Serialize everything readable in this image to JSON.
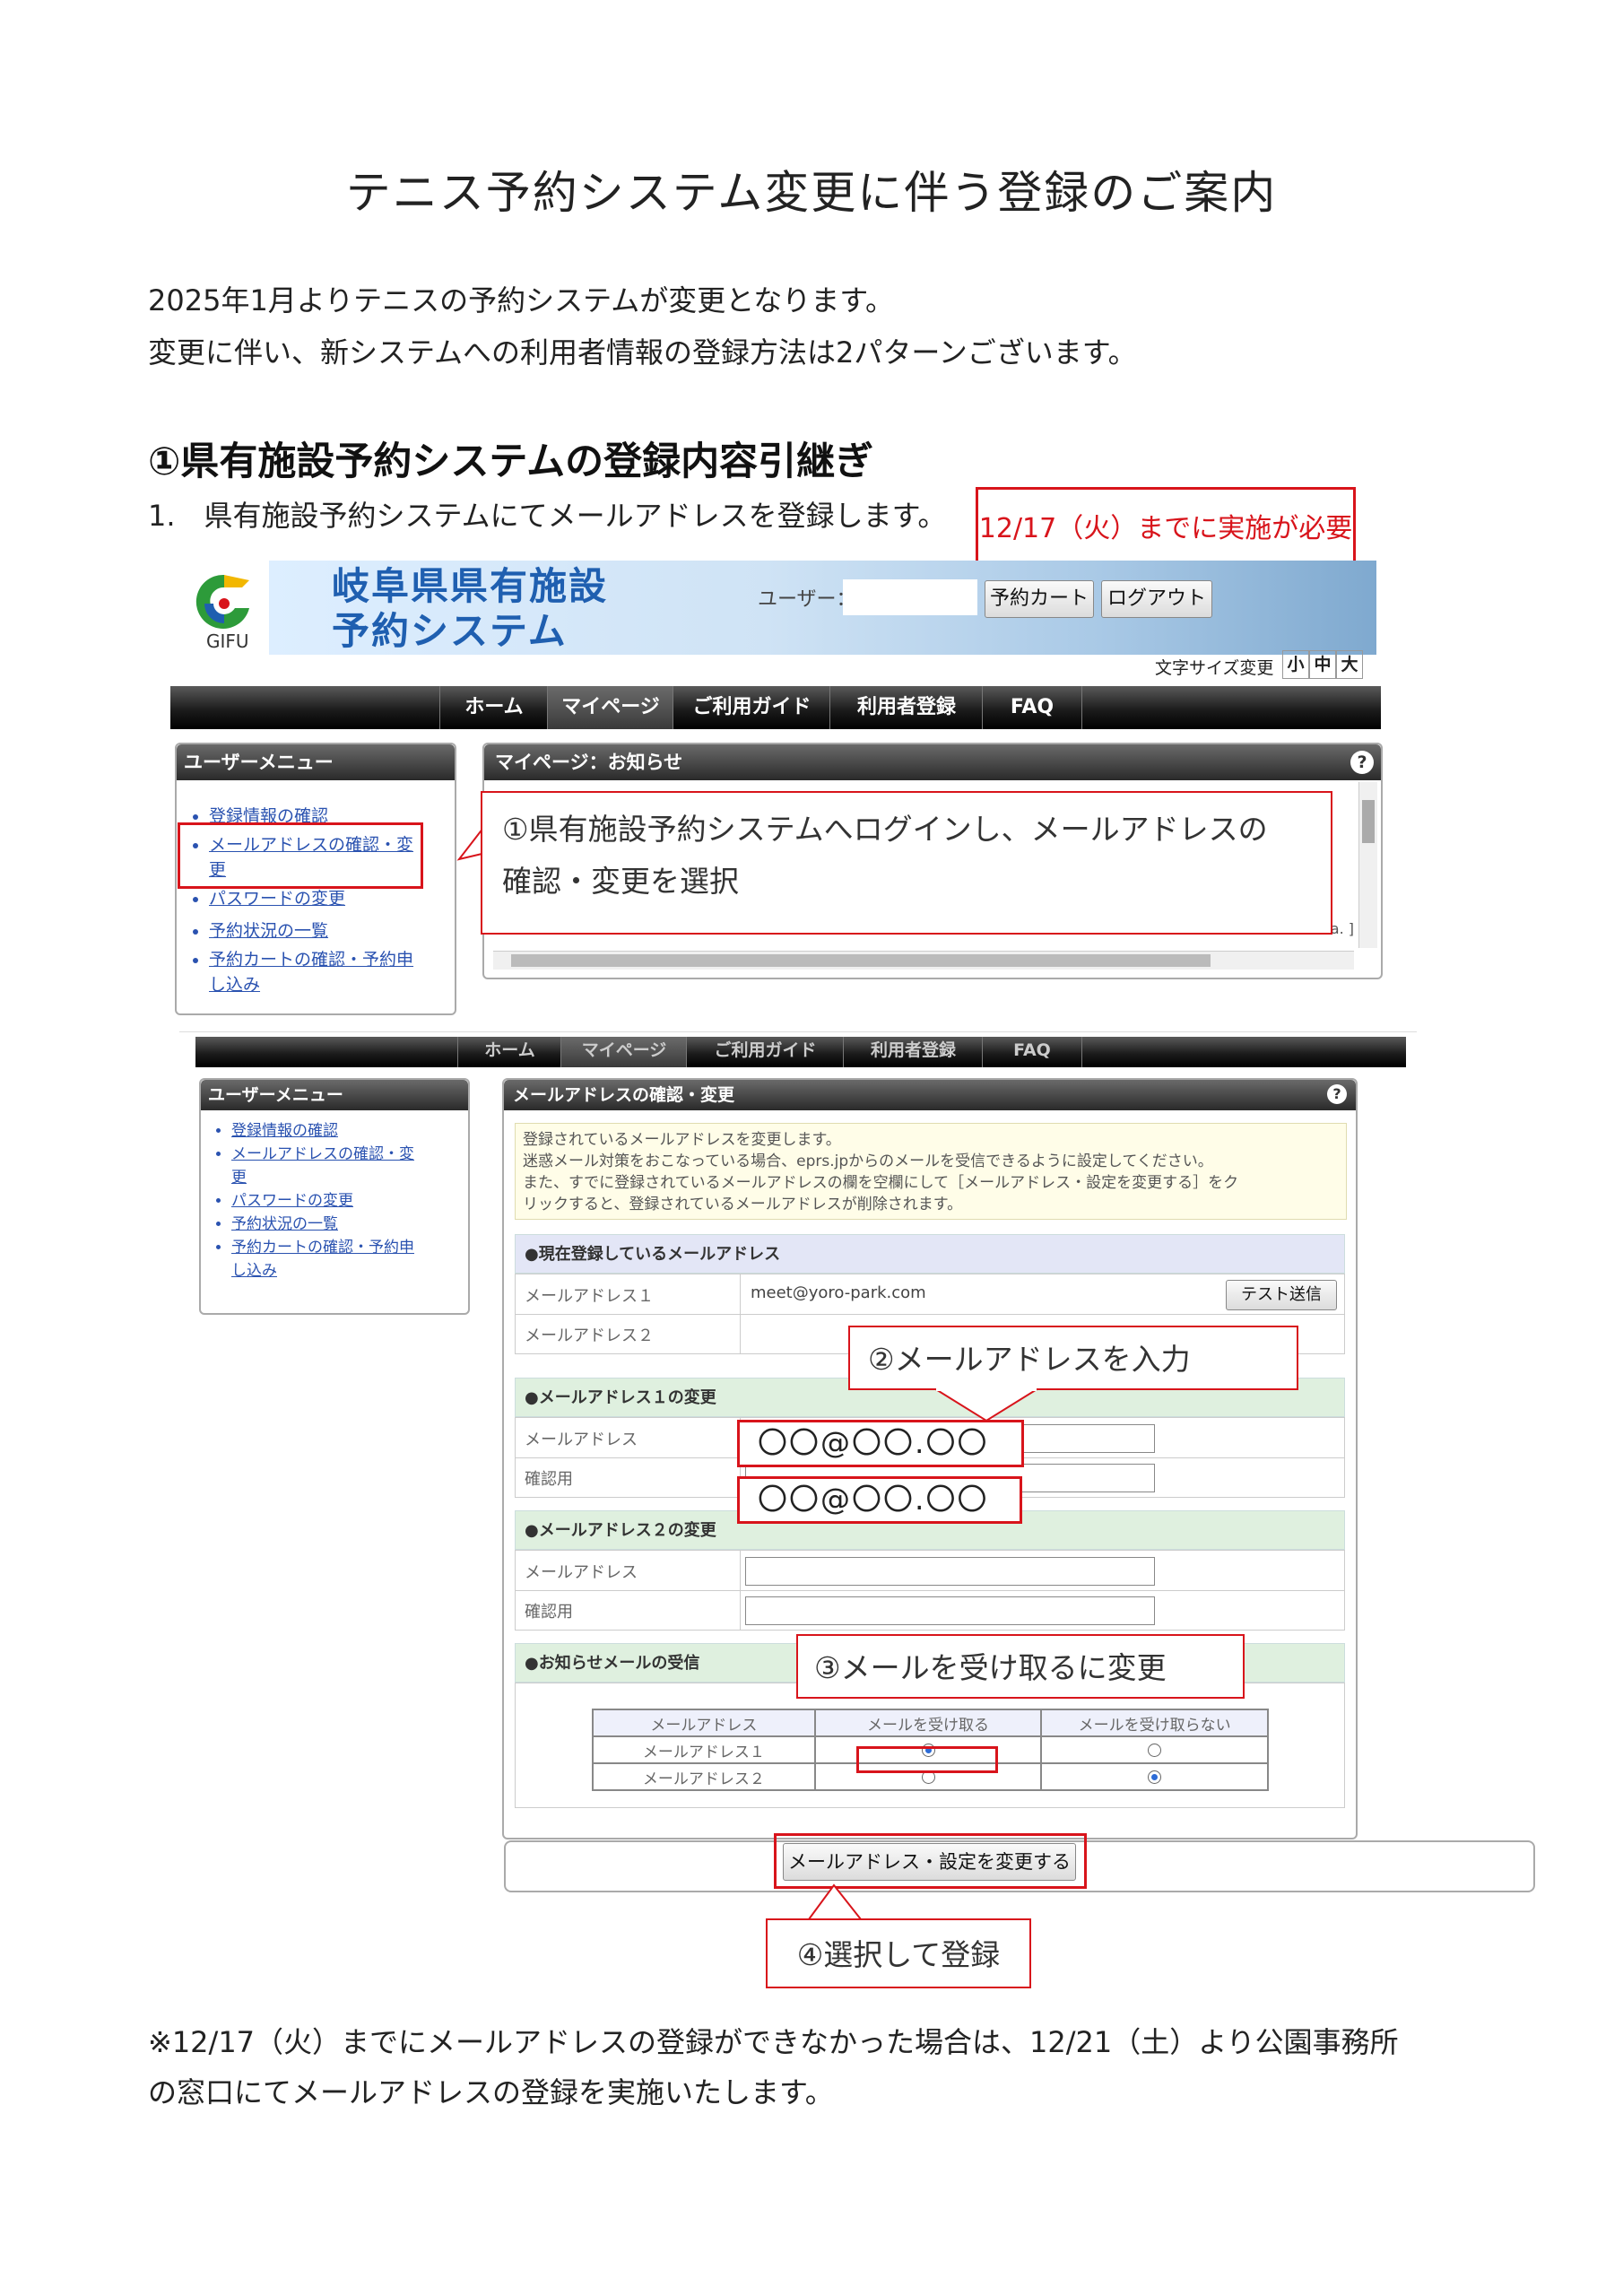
{
  "doc": {
    "title": "テニス予約システム変更に伴う登録のご案内",
    "intro1": "2025年1月よりテニスの予約システムが変更となります。",
    "intro2": "変更に伴い、新システムへの利用者情報の登録方法は2パターンございます。",
    "section1": "①県有施設予約システムの登録内容引継ぎ",
    "step1": "1.　県有施設予約システムにてメールアドレスを登録します。",
    "deadline": "12/17（火）までに実施が必要",
    "footnote1": "※12/17（火）までにメールアドレスの登録ができなかった場合は、12/21（土）より公園事務所",
    "footnote2": "の窓口にてメールアドレスの登録を実施いたします。"
  },
  "site": {
    "logo_text": "GIFU",
    "name_line1": "岐阜県県有施設",
    "name_line2": "予約システム",
    "user_label": "ユーザー：",
    "cart_button": "予約カート",
    "logout_button": "ログアウト",
    "font_size_label": "文字サイズ変更",
    "font_small": "小",
    "font_mid": "中",
    "font_large": "大",
    "nav": [
      "ホーム",
      "マイページ",
      "ご利用ガイド",
      "利用者登録",
      "FAQ"
    ]
  },
  "user_menu": {
    "title": "ユーザーメニュー",
    "items": [
      "登録情報の確認",
      "メールアドレスの確認・変更",
      "パスワードの変更",
      "予約状況の一覧",
      "予約カートの確認・予約申し込み"
    ],
    "items1_wrapped": [
      "メールアドレスの確認・変",
      "更"
    ],
    "items4_wrapped": [
      "予約カートの確認・予約申",
      "し込み"
    ]
  },
  "notice_panel": {
    "title": "マイページ：お知らせ",
    "help": "?",
    "tail": "a. ]"
  },
  "email_page": {
    "title": "メールアドレスの確認・変更",
    "help": "?",
    "info1": "登録されているメールアドレスを変更します。",
    "info2": "迷惑メール対策をおこなっている場合、eprs.jpからのメールを受信できるように設定してください。",
    "info3": "また、すでに登録されているメールアドレスの欄を空欄にして［メールアドレス・設定を変更する］をク",
    "info4": "リックすると、登録されているメールアドレスが削除されます。",
    "current_header": "●現在登録しているメールアドレス",
    "current_label1": "メールアドレス１",
    "current_value1": "meet@yoro-park.com",
    "test_send": "テスト送信",
    "current_label2": "メールアドレス２",
    "change1_header": "●メールアドレス１の変更",
    "change2_header": "●メールアドレス２の変更",
    "email_label": "メールアドレス",
    "confirm_label": "確認用",
    "masked_email": "〇〇@〇〇.〇〇",
    "notify_header": "●お知らせメールの受信",
    "table_headers": [
      "メールアドレス",
      "メールを受け取る",
      "メールを受け取らない"
    ],
    "table_rows": [
      {
        "label": "メールアドレス１",
        "receive": true
      },
      {
        "label": "メールアドレス２",
        "receive": false
      }
    ],
    "submit": "メールアドレス・設定を変更する"
  },
  "callouts": {
    "c1_line1": "①県有施設予約システムへログインし、メールアドレスの",
    "c1_line2": "確認・変更を選択",
    "c2": "②メールアドレスを入力",
    "c3": "③メールを受け取るに変更",
    "c4": "④選択して登録"
  },
  "colors": {
    "accent_red": "#d8141b",
    "link_blue": "#2a52b0"
  }
}
